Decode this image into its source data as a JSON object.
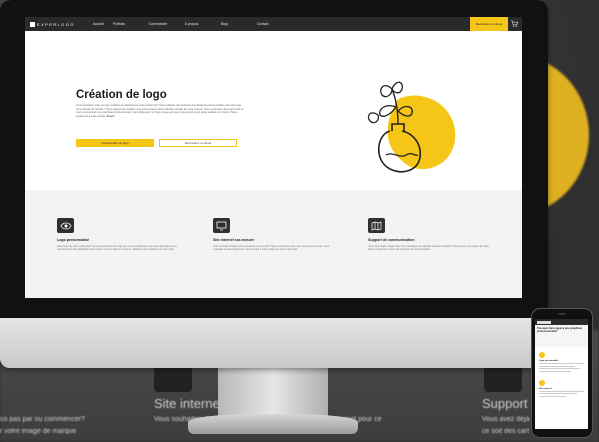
{
  "nav": {
    "logo": "EXPERLOGO",
    "links": [
      "Accueil",
      "Portfolio",
      "Commander",
      "À propos",
      "Blog",
      "Contact"
    ],
    "cta": "Demandez un devis"
  },
  "hero": {
    "title": "Création de logo",
    "text": "Vous souhaitez créer un logo moderne et original pour votre entreprise? Vous sollicitez des services d'un designer pour la création de votre logo ou la refonte de l'ancien ? Notre agence de création vous accompagne dans l'identité visuelle de votre marque. Nous proposons des logos clés en main et créés par nos graphistes professionnels. Vous obtiendrez un logo unique qui vous correspond et qui saura séduire vos clients. Notre équipe est à votre écoute.",
    "text_strong": "Reach",
    "primary_button": "Commander un logo",
    "secondary_button": "Demandez un devis"
  },
  "services": [
    {
      "icon": "eye-icon",
      "title": "Logo personnalisé",
      "text": "Vous avez de votre entreprise? Vous avez besoin d'un logo qui vous correspond et qui vous démarque de la concurrence? Nos graphistes créent pour vous un logo sur mesure, adapté à votre activité et à votre cible."
    },
    {
      "icon": "monitor-icon",
      "title": "Site internet sur-mesure",
      "text": "Vous souhaitez diriger votre entreprise vers le web? Nous concevons votre site internet sur mesure, de la maquette au développement, pour un site à votre image qui vous ressemble."
    },
    {
      "icon": "map-icon",
      "title": "Support de communication",
      "text": "Vous avez déjà un logo mais vous souhaitez une identité visuelle complète? Nous créons vos cartes de visite, flyers, brochures et tous vos supports de communication."
    }
  ],
  "phone": {
    "head_title": "Pourquoi faire appel à une graphiste professionnelle?",
    "section_titles": [
      "Logo personnalisé",
      "Site internet"
    ]
  },
  "background": {
    "word_left": "Site internet s",
    "word_right": "Support de",
    "line_left_1": "co pas par ou commencer?",
    "line_left_2": "r votre image de marque",
    "line_mid_1": "Vous souhaitez di",
    "line_mid_2": "site internet pour ce",
    "line_right_1": "Vous avez déjà",
    "line_right_2": "ce soit des cart"
  },
  "colors": {
    "accent": "#f5c518",
    "dark": "#2a2a2a"
  }
}
